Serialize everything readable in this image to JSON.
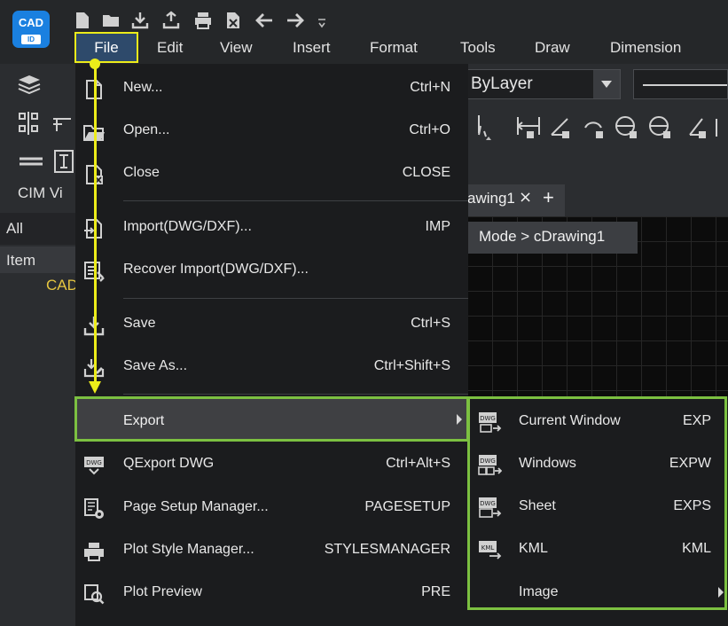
{
  "app": {
    "logo_text": "CAD",
    "logo_badge": "ID"
  },
  "menubar": {
    "items": [
      "File",
      "Edit",
      "View",
      "Insert",
      "Format",
      "Tools",
      "Draw",
      "Dimension"
    ]
  },
  "toolbar": {
    "layer_value": "ByLayer"
  },
  "left_panel": {
    "title": "CIM Vi",
    "filter": "All",
    "header": "Item",
    "entry": "CAD"
  },
  "drawing": {
    "tab_label": "awing1",
    "tab_close": "×",
    "tab_add": "+",
    "breadcrumb": "Mode > cDrawing1"
  },
  "file_menu": {
    "items": [
      {
        "label": "New...",
        "shortcut": "Ctrl+N",
        "icon": "new-file-icon"
      },
      {
        "label": "Open...",
        "shortcut": "Ctrl+O",
        "icon": "open-folder-icon"
      },
      {
        "label": "Close",
        "shortcut": "CLOSE",
        "icon": "close-file-icon"
      },
      {
        "label": "Import(DWG/DXF)...",
        "shortcut": "IMP",
        "icon": "import-icon"
      },
      {
        "label": "Recover Import(DWG/DXF)...",
        "shortcut": "",
        "icon": "recover-import-icon"
      },
      {
        "label": "Save",
        "shortcut": "Ctrl+S",
        "icon": "save-icon"
      },
      {
        "label": "Save As...",
        "shortcut": "Ctrl+Shift+S",
        "icon": "save-as-icon"
      },
      {
        "label": "Export",
        "shortcut": "",
        "icon": ""
      },
      {
        "label": "QExport DWG",
        "shortcut": "Ctrl+Alt+S",
        "icon": "dwg-export-icon"
      },
      {
        "label": "Page Setup Manager...",
        "shortcut": "PAGESETUP",
        "icon": "page-setup-icon"
      },
      {
        "label": "Plot Style Manager...",
        "shortcut": "STYLESMANAGER",
        "icon": "plot-style-icon"
      },
      {
        "label": "Plot Preview",
        "shortcut": "PRE",
        "icon": "plot-preview-icon"
      }
    ]
  },
  "export_submenu": {
    "items": [
      {
        "label": "Current Window",
        "shortcut": "EXP",
        "icon": "dwg-window-icon"
      },
      {
        "label": "Windows",
        "shortcut": "EXPW",
        "icon": "dwg-windows-icon"
      },
      {
        "label": "Sheet",
        "shortcut": "EXPS",
        "icon": "dwg-sheet-icon"
      },
      {
        "label": "KML",
        "shortcut": "KML",
        "icon": "kml-icon"
      },
      {
        "label": "Image",
        "shortcut": "",
        "icon": ""
      }
    ]
  },
  "colors": {
    "highlight_yellow": "#ecec1a",
    "highlight_green": "#7cc041",
    "menu_bg": "#1b1c1e"
  }
}
